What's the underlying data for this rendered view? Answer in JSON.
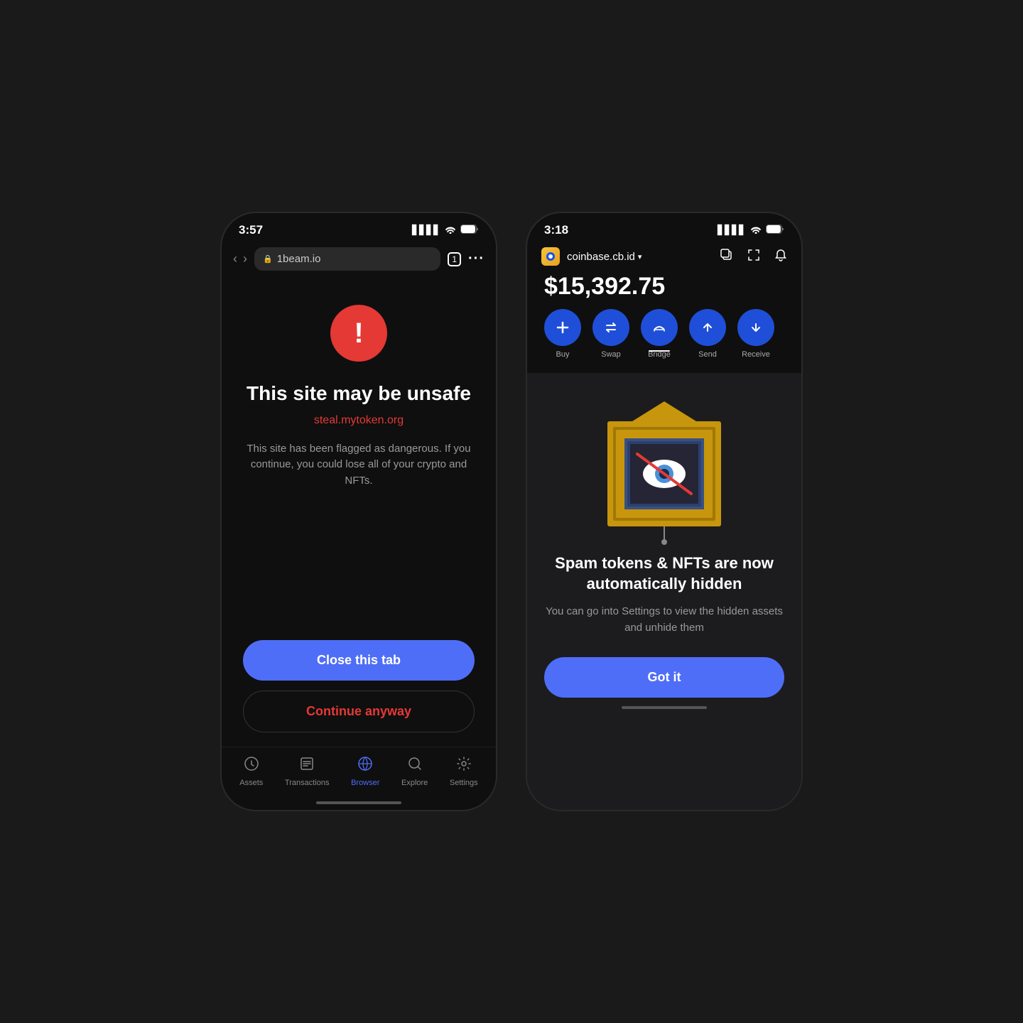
{
  "phone1": {
    "status": {
      "time": "3:57",
      "signal": "▋▋▋▋",
      "wifi": "WiFi",
      "battery": "🔋"
    },
    "nav": {
      "url": "1beam.io",
      "tab_count": "1"
    },
    "danger_icon": "!",
    "title": "This site may be unsafe",
    "unsafe_url": "steal.mytoken.org",
    "description": "This site has been flagged as dangerous. If you continue, you could lose all of your crypto and NFTs.",
    "close_tab_label": "Close this tab",
    "continue_label": "Continue anyway",
    "bottom_nav": {
      "items": [
        {
          "label": "Assets",
          "icon": "🕐",
          "active": false
        },
        {
          "label": "Transactions",
          "icon": "📋",
          "active": false
        },
        {
          "label": "Browser",
          "icon": "🌐",
          "active": true
        },
        {
          "label": "Explore",
          "icon": "🔍",
          "active": false
        },
        {
          "label": "Settings",
          "icon": "⚙️",
          "active": false
        }
      ]
    }
  },
  "phone2": {
    "status": {
      "time": "3:18"
    },
    "header": {
      "site_icon": "🔒",
      "site_name": "coinbase.cb.id",
      "chevron": "▾"
    },
    "balance": "$15,392.75",
    "action_buttons": [
      {
        "label": "Buy",
        "icon": "+",
        "active": false
      },
      {
        "label": "Swap",
        "icon": "⇄",
        "active": false
      },
      {
        "label": "Bridge",
        "icon": "⌓",
        "active": true
      },
      {
        "label": "Send",
        "icon": "↑",
        "active": false
      },
      {
        "label": "Receive",
        "icon": "↓",
        "active": false
      }
    ],
    "modal": {
      "title": "Spam tokens & NFTs are now automatically hidden",
      "description": "You can go into Settings to view the hidden assets and unhide them",
      "got_it_label": "Got it"
    }
  }
}
